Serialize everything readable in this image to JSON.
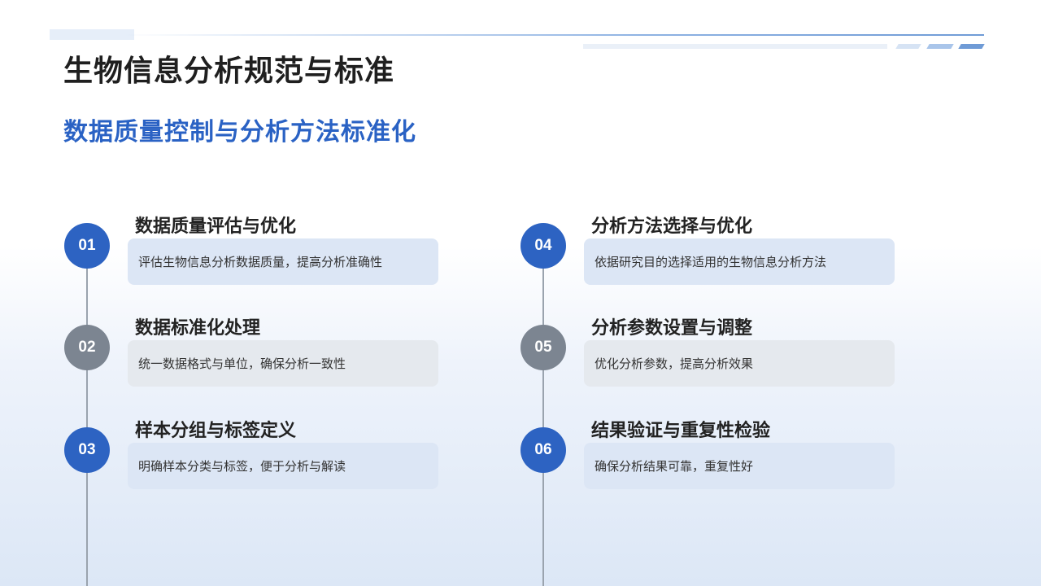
{
  "title": "生物信息分析规范与标准",
  "subtitle": "数据质量控制与分析方法标准化",
  "items": [
    {
      "number": "01",
      "title": "数据质量评估与优化",
      "description": "评估生物信息分析数据质量，提高分析准确性"
    },
    {
      "number": "02",
      "title": "数据标准化处理",
      "description": "统一数据格式与单位，确保分析一致性"
    },
    {
      "number": "03",
      "title": "样本分组与标签定义",
      "description": "明确样本分类与标签，便于分析与解读"
    },
    {
      "number": "04",
      "title": "分析方法选择与优化",
      "description": "依据研究目的选择适用的生物信息分析方法"
    },
    {
      "number": "05",
      "title": "分析参数设置与调整",
      "description": "优化分析参数，提高分析效果"
    },
    {
      "number": "06",
      "title": "结果验证与重复性检验",
      "description": "确保分析结果可靠，重复性好"
    }
  ],
  "colors": {
    "accent": "#2d63c2",
    "secondary": "#7c8591",
    "title": "#1f1f1f"
  }
}
